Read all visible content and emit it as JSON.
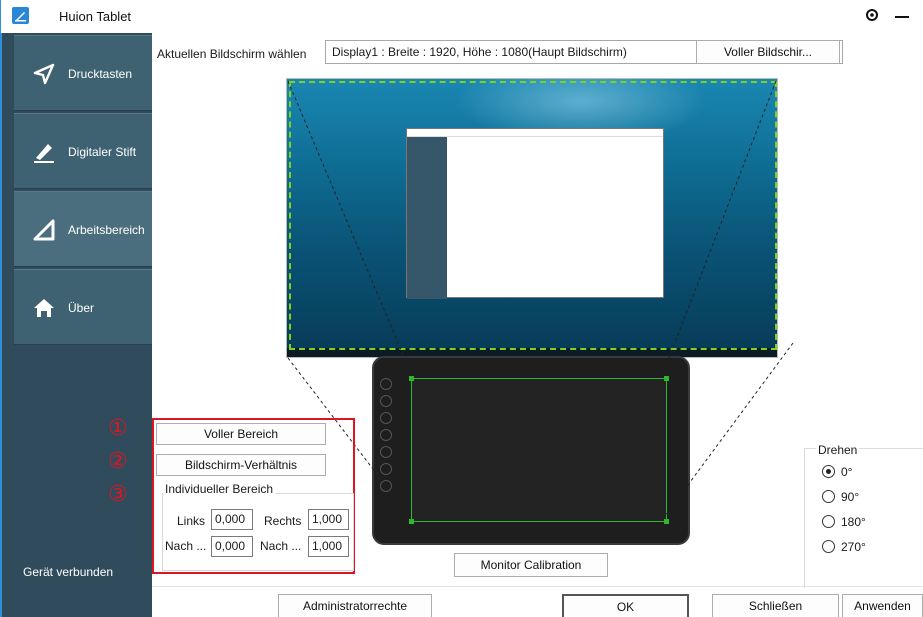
{
  "window": {
    "title": "Huion Tablet"
  },
  "sidebar": {
    "items": [
      {
        "label": "Drucktasten",
        "icon": "send-arrow-icon",
        "active": false
      },
      {
        "label": "Digitaler Stift",
        "icon": "pen-icon",
        "active": false
      },
      {
        "label": "Arbeitsbereich",
        "icon": "triangle-ruler-icon",
        "active": true
      },
      {
        "label": "Über",
        "icon": "home-icon",
        "active": false
      }
    ],
    "status": "Gerät verbunden"
  },
  "screen": {
    "label": "Aktuellen Bildschirm wählen",
    "selected": "Display1 : Breite : 1920, Höhe : 1080(Haupt Bildschirm)",
    "fullscreen_button": "Voller Bildschir..."
  },
  "mapping": {
    "numbers": [
      "①",
      "②",
      "③"
    ],
    "full_area_button": "Voller Bereich",
    "ratio_button": "Bildschirm-Verhältnis",
    "custom_legend": "Individueller Bereich",
    "left_label": "Links",
    "left_value": "0,000",
    "right_label": "Rechts",
    "right_value": "1,000",
    "top_label": "Nach ...",
    "top_value": "0,000",
    "bottom_label": "Nach ...",
    "bottom_value": "1,000"
  },
  "rotate": {
    "legend": "Drehen",
    "options": [
      {
        "label": "0°",
        "checked": true
      },
      {
        "label": "90°",
        "checked": false
      },
      {
        "label": "180°",
        "checked": false
      },
      {
        "label": "270°",
        "checked": false
      }
    ]
  },
  "calibration_button": "Monitor Calibration",
  "footer": {
    "admin_button": "Administratorrechte",
    "ok_button": "OK",
    "close_button": "Schließen",
    "apply_button": "Anwenden"
  },
  "colors": {
    "accent": "#2f8fd8",
    "sidebar_bg": "#304c5c",
    "highlight_red": "#e0141e",
    "active_area_green": "#2db82d"
  }
}
